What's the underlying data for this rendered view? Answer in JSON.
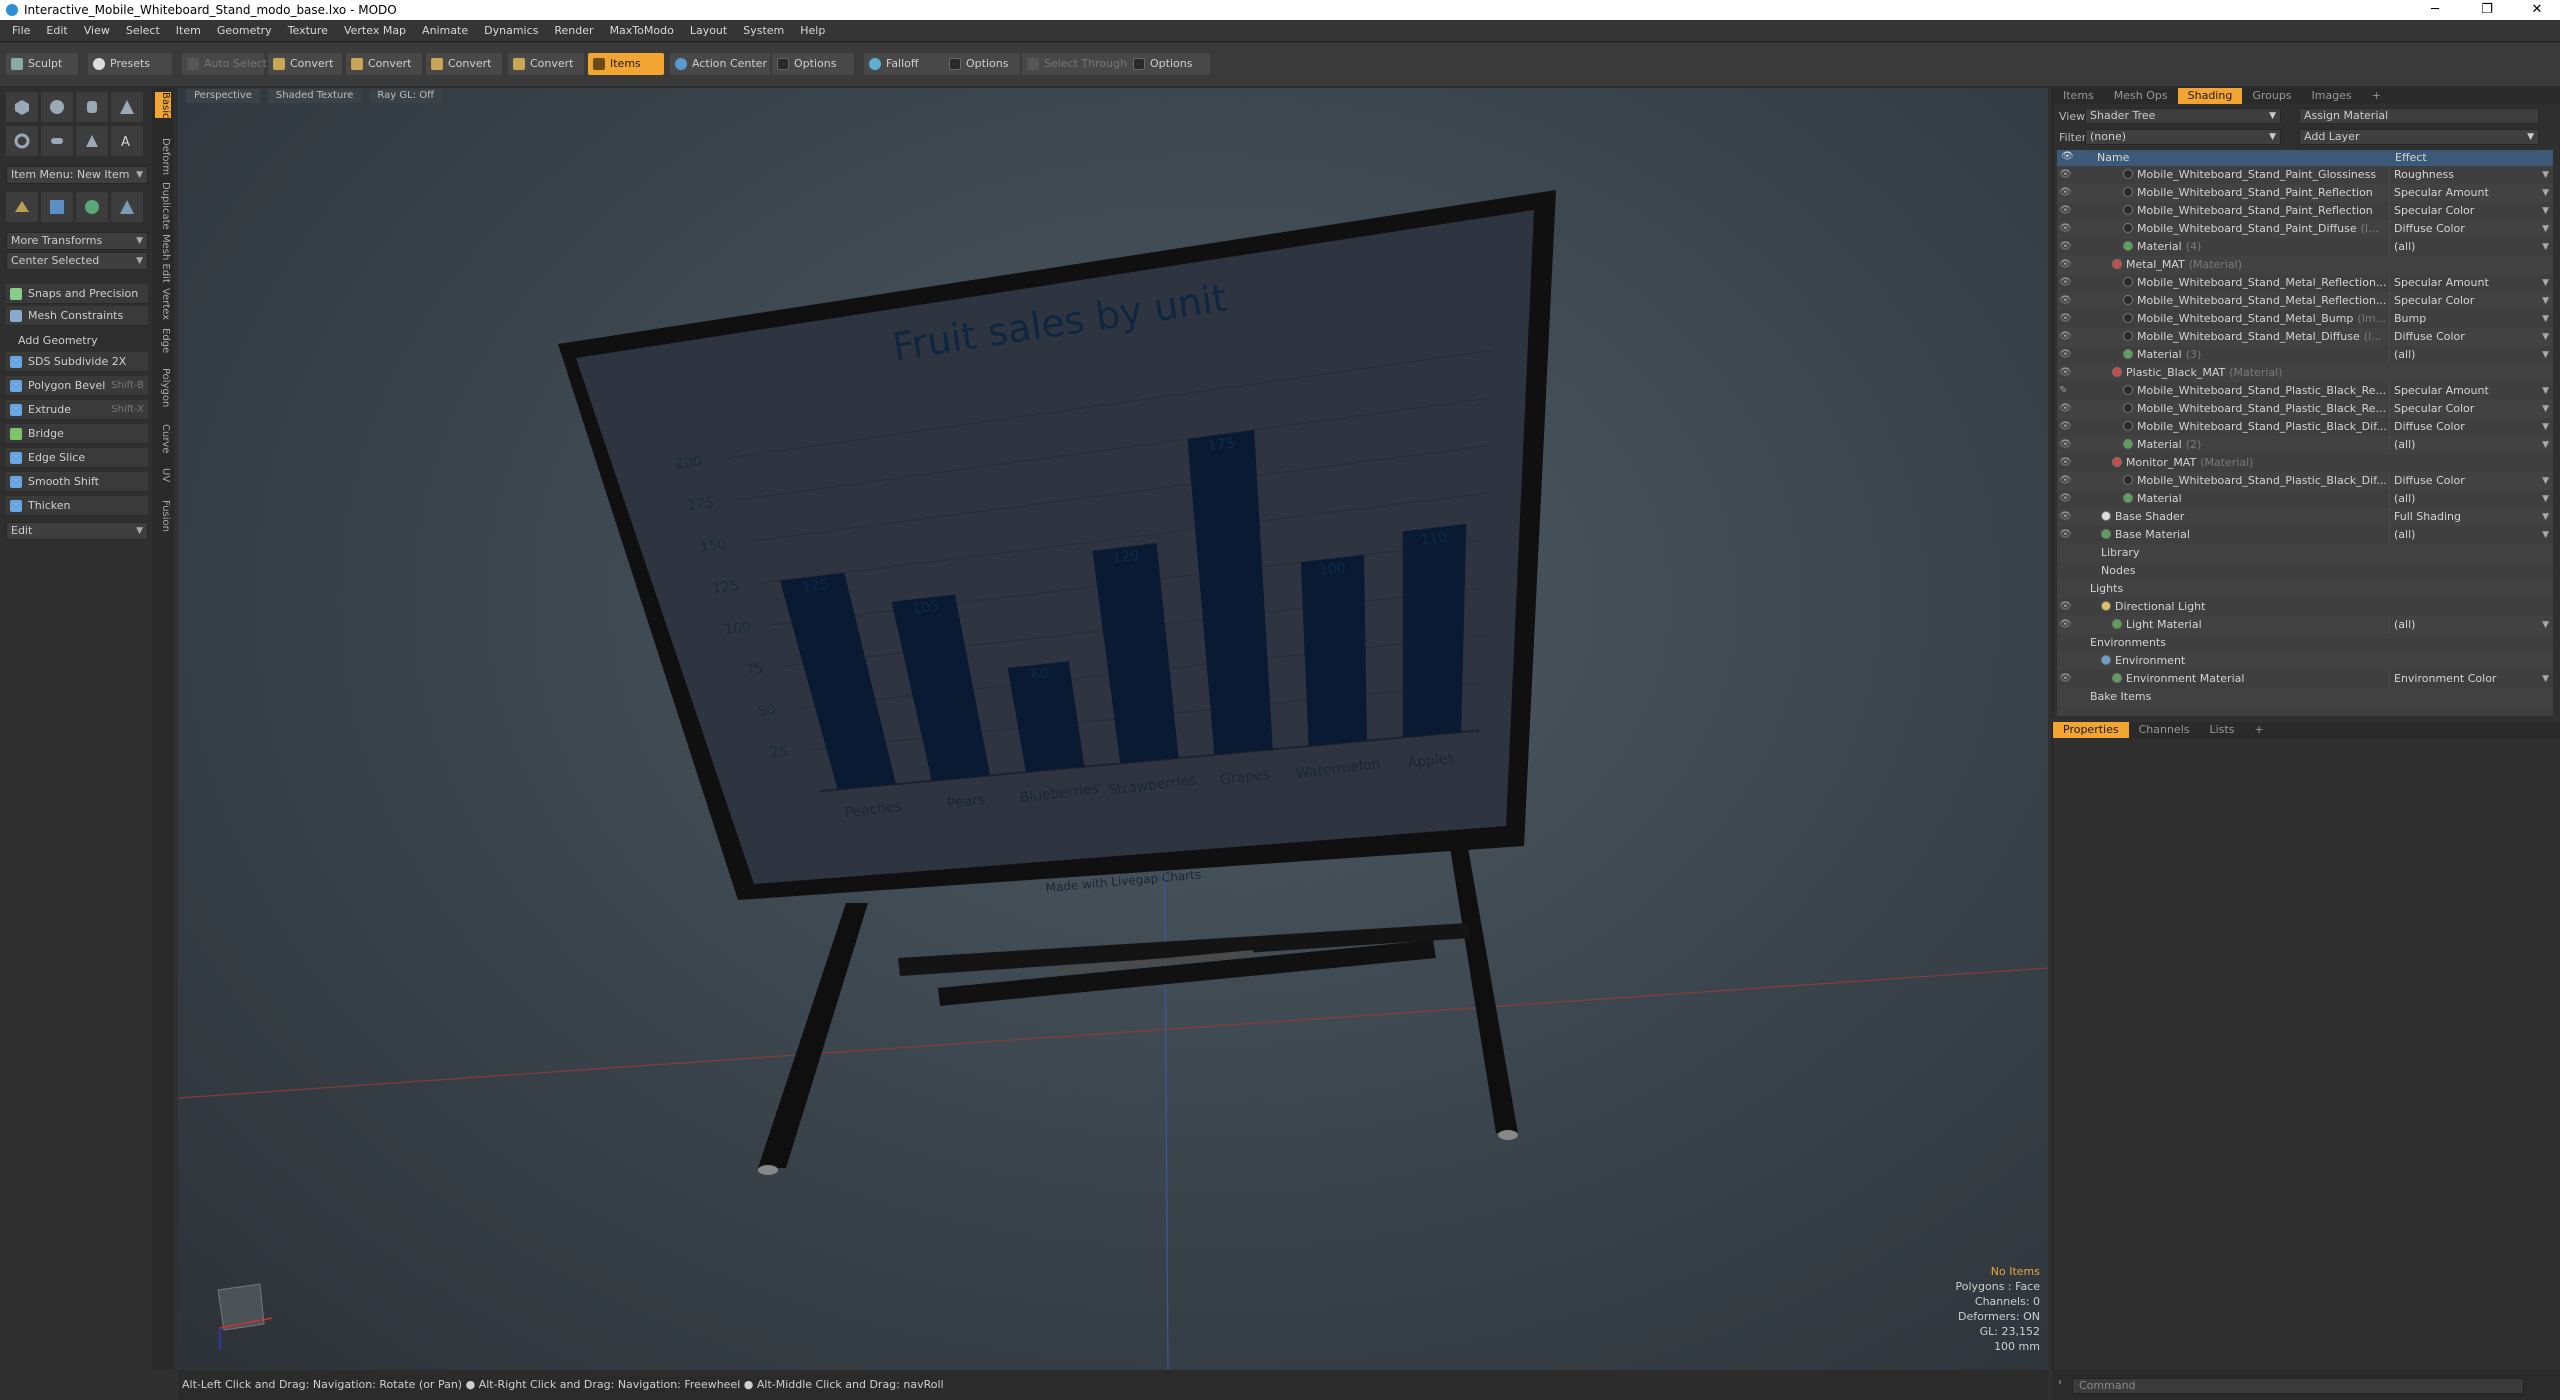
{
  "window": {
    "title": "Interactive_Mobile_Whiteboard_Stand_modo_base.lxo - MODO",
    "minimize": "─",
    "maximize": "❐",
    "close": "✕"
  },
  "menu": [
    "File",
    "Edit",
    "View",
    "Select",
    "Item",
    "Geometry",
    "Texture",
    "Vertex Map",
    "Animate",
    "Dynamics",
    "Render",
    "MaxToModo",
    "Layout",
    "System",
    "Help"
  ],
  "toolbar": {
    "sculpt": "Sculpt",
    "presets": "Presets",
    "auto_select": "Auto Select",
    "convert1": "Convert",
    "convert2": "Convert",
    "convert3": "Convert",
    "convert4": "Convert",
    "items": "Items",
    "action_center": "Action Center",
    "options1": "Options",
    "falloff": "Falloff",
    "options2": "Options",
    "select_through": "Select Through",
    "options3": "Options"
  },
  "left": {
    "item_menu": "Item Menu: New Item",
    "more_transforms": "More Transforms",
    "center_selected": "Center Selected",
    "snaps": "Snaps and Precision",
    "mesh_constraints": "Mesh Constraints",
    "add_geometry": "Add Geometry",
    "tools": [
      {
        "label": "SDS Subdivide 2X",
        "shortcut": "",
        "color": "#6aa7e0"
      },
      {
        "label": "Polygon Bevel",
        "shortcut": "Shift-B",
        "color": "#6aa7e0"
      },
      {
        "label": "Extrude",
        "shortcut": "Shift-X",
        "color": "#6aa7e0"
      },
      {
        "label": "Bridge",
        "shortcut": "",
        "color": "#7fc46a"
      },
      {
        "label": "Edge Slice",
        "shortcut": "",
        "color": "#6aa7e0"
      },
      {
        "label": "Smooth Shift",
        "shortcut": "",
        "color": "#6aa7e0"
      },
      {
        "label": "Thicken",
        "shortcut": "",
        "color": "#6aa7e0"
      }
    ],
    "edit": "Edit",
    "vtabs": [
      "Basic",
      "Deform",
      "Duplicate",
      "Mesh Edit",
      "Vertex",
      "Edge",
      "Polygon",
      "Curve",
      "UV",
      "Fusion"
    ]
  },
  "viewport": {
    "perspective": "Perspective",
    "shaded": "Shaded Texture",
    "raygl": "Ray GL: Off",
    "info": {
      "no_items": "No Items",
      "polygons": "Polygons : Face",
      "channels": "Channels: 0",
      "deformers": "Deformers: ON",
      "gl": "GL: 23,152",
      "scale": "100 mm"
    }
  },
  "board": {
    "watermark": "Made with Livegap Charts"
  },
  "chart_data": {
    "type": "bar",
    "title": "Fruit sales by unit",
    "categories": [
      "Peaches",
      "Pears",
      "Blueberries",
      "Strawberries",
      "Grapes",
      "Watermelon",
      "Apples"
    ],
    "values": [
      125,
      105,
      60,
      120,
      175,
      100,
      110
    ],
    "yticks": [
      25,
      50,
      75,
      100,
      125,
      150,
      175,
      200
    ],
    "ylim": [
      0,
      200
    ],
    "xlabel": "",
    "ylabel": "",
    "bar_color": "#0a1a33"
  },
  "status": "Alt-Left Click and Drag: Navigation: Rotate (or Pan) ● Alt-Right Click and Drag: Navigation: Freewheel ● Alt-Middle Click and Drag: navRoll",
  "command_placeholder": "Command",
  "shading": {
    "tabs": [
      "Items",
      "Mesh Ops",
      "Shading",
      "Groups",
      "Images",
      "+"
    ],
    "view_label": "View",
    "view_value": "Shader Tree",
    "assign_material": "Assign Material",
    "filter_label": "Filter",
    "filter_value": "(none)",
    "add_layer": "Add Layer",
    "col_name": "Name",
    "col_effect": "Effect",
    "rows": [
      {
        "indent": 4,
        "name": "Mobile_Whiteboard_Stand_Paint_Glossiness",
        "note": "",
        "effect": "Roughness",
        "dot": "#2a2a2a",
        "eye": "👁"
      },
      {
        "indent": 4,
        "name": "Mobile_Whiteboard_Stand_Paint_Reflection",
        "note": "",
        "effect": "Specular Amount",
        "dot": "#2a2a2a",
        "eye": "👁"
      },
      {
        "indent": 4,
        "name": "Mobile_Whiteboard_Stand_Paint_Reflection",
        "note": "",
        "effect": "Specular Color",
        "dot": "#2a2a2a",
        "eye": "👁"
      },
      {
        "indent": 4,
        "name": "Mobile_Whiteboard_Stand_Paint_Diffuse",
        "note": "(I...",
        "effect": "Diffuse Color",
        "dot": "#2a2a2a",
        "eye": "👁"
      },
      {
        "indent": 4,
        "name": "Material",
        "note": "(4)",
        "effect": "(all)",
        "dot": "#5aa05a",
        "eye": "👁"
      },
      {
        "indent": 3,
        "name": "Metal_MAT",
        "note": "(Material)",
        "effect": "",
        "dot": "#c84a4a",
        "eye": "👁"
      },
      {
        "indent": 4,
        "name": "Mobile_Whiteboard_Stand_Metal_Reflection...",
        "note": "",
        "effect": "Specular Amount",
        "dot": "#2a2a2a",
        "eye": "👁"
      },
      {
        "indent": 4,
        "name": "Mobile_Whiteboard_Stand_Metal_Reflection...",
        "note": "",
        "effect": "Specular Color",
        "dot": "#2a2a2a",
        "eye": "👁"
      },
      {
        "indent": 4,
        "name": "Mobile_Whiteboard_Stand_Metal_Bump",
        "note": "(Im...",
        "effect": "Bump",
        "dot": "#2a2a2a",
        "eye": "👁"
      },
      {
        "indent": 4,
        "name": "Mobile_Whiteboard_Stand_Metal_Diffuse",
        "note": "(I...",
        "effect": "Diffuse Color",
        "dot": "#2a2a2a",
        "eye": "👁"
      },
      {
        "indent": 4,
        "name": "Material",
        "note": "(3)",
        "effect": "(all)",
        "dot": "#5aa05a",
        "eye": "👁"
      },
      {
        "indent": 3,
        "name": "Plastic_Black_MAT",
        "note": "(Material)",
        "effect": "",
        "dot": "#c84a4a",
        "eye": "👁"
      },
      {
        "indent": 4,
        "name": "Mobile_Whiteboard_Stand_Plastic_Black_Re...",
        "note": "",
        "effect": "Specular Amount",
        "dot": "#2a2a2a",
        "eye": "✎"
      },
      {
        "indent": 4,
        "name": "Mobile_Whiteboard_Stand_Plastic_Black_Re...",
        "note": "",
        "effect": "Specular Color",
        "dot": "#2a2a2a",
        "eye": "👁"
      },
      {
        "indent": 4,
        "name": "Mobile_Whiteboard_Stand_Plastic_Black_Dif...",
        "note": "",
        "effect": "Diffuse Color",
        "dot": "#2a2a2a",
        "eye": "👁"
      },
      {
        "indent": 4,
        "name": "Material",
        "note": "(2)",
        "effect": "(all)",
        "dot": "#5aa05a",
        "eye": "👁"
      },
      {
        "indent": 3,
        "name": "Monitor_MAT",
        "note": "(Material)",
        "effect": "",
        "dot": "#c84a4a",
        "eye": "👁"
      },
      {
        "indent": 4,
        "name": "Mobile_Whiteboard_Stand_Plastic_Black_Dif...",
        "note": "",
        "effect": "Diffuse Color",
        "dot": "#2a2a2a",
        "eye": "👁"
      },
      {
        "indent": 4,
        "name": "Material",
        "note": "",
        "effect": "(all)",
        "dot": "#5aa05a",
        "eye": "👁"
      },
      {
        "indent": 2,
        "name": "Base Shader",
        "note": "",
        "effect": "Full Shading",
        "dot": "#dcdcdc",
        "eye": "👁"
      },
      {
        "indent": 2,
        "name": "Base Material",
        "note": "",
        "effect": "(all)",
        "dot": "#5aa05a",
        "eye": "👁"
      },
      {
        "indent": 2,
        "name": "Library",
        "note": "",
        "effect": "",
        "dot": "",
        "eye": ""
      },
      {
        "indent": 2,
        "name": "Nodes",
        "note": "",
        "effect": "",
        "dot": "",
        "eye": ""
      },
      {
        "indent": 1,
        "name": "Lights",
        "note": "",
        "effect": "",
        "dot": "",
        "eye": ""
      },
      {
        "indent": 2,
        "name": "Directional Light",
        "note": "",
        "effect": "",
        "dot": "#e0c060",
        "eye": "👁"
      },
      {
        "indent": 3,
        "name": "Light Material",
        "note": "",
        "effect": "(all)",
        "dot": "#5aa05a",
        "eye": "👁"
      },
      {
        "indent": 1,
        "name": "Environments",
        "note": "",
        "effect": "",
        "dot": "",
        "eye": ""
      },
      {
        "indent": 2,
        "name": "Environment",
        "note": "",
        "effect": "",
        "dot": "#6aa0d0",
        "eye": ""
      },
      {
        "indent": 3,
        "name": "Environment Material",
        "note": "",
        "effect": "Environment Color",
        "dot": "#5aa05a",
        "eye": "👁"
      },
      {
        "indent": 1,
        "name": "Bake Items",
        "note": "",
        "effect": "",
        "dot": "",
        "eye": ""
      }
    ]
  },
  "properties": {
    "tabs": [
      "Properties",
      "Channels",
      "Lists",
      "+"
    ]
  }
}
